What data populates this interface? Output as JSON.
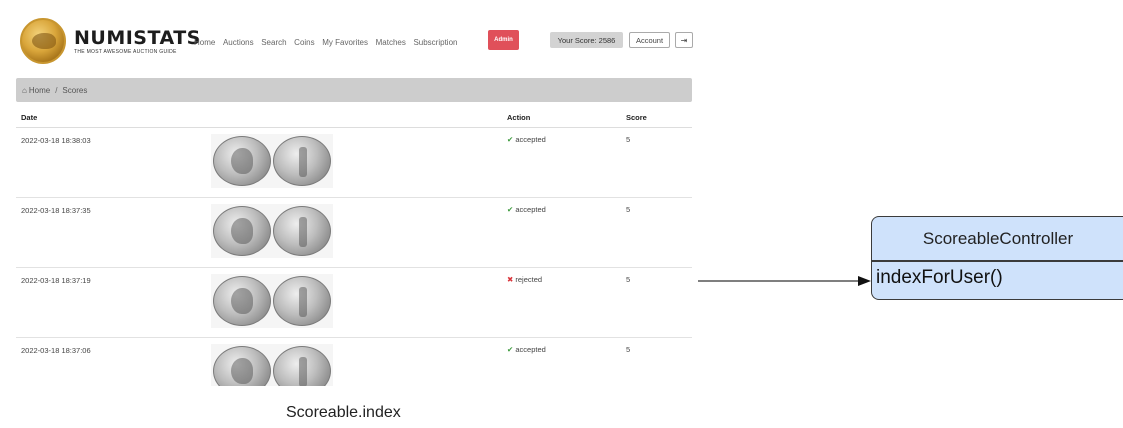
{
  "screenshot": {
    "logo": {
      "title": "NUMISTATS",
      "subtitle": "THE MOST AWESOME AUCTION GUIDE"
    },
    "nav": [
      "Home",
      "Auctions",
      "Search",
      "Coins",
      "My Favorites",
      "Matches",
      "Subscription"
    ],
    "admin_label": "Admin",
    "score_label": "Your Score: 2586",
    "account_label": "Account",
    "logout_icon": "sign-out-icon",
    "breadcrumb": {
      "home_icon": "⌂",
      "home": "Home",
      "sep": "/",
      "current": "Scores"
    },
    "table": {
      "headers": {
        "date": "Date",
        "action": "Action",
        "score": "Score"
      },
      "rows": [
        {
          "date": "2022-03-18 18:38:03",
          "status_icon": "✔",
          "action": "accepted",
          "score": "5"
        },
        {
          "date": "2022-03-18 18:37:35",
          "status_icon": "✔",
          "action": "accepted",
          "score": "5"
        },
        {
          "date": "2022-03-18 18:37:19",
          "status_icon": "✖",
          "action": "rejected",
          "score": "5"
        },
        {
          "date": "2022-03-18 18:37:06",
          "status_icon": "✔",
          "action": "accepted",
          "score": "5"
        }
      ]
    }
  },
  "caption": "Scoreable.index",
  "class_box": {
    "name": "ScoreableController",
    "method": "indexForUser()"
  },
  "colors": {
    "class_fill": "#cfe2fb",
    "admin": "#e0505a",
    "accepted": "#3a9a3a",
    "rejected": "#d9343a"
  }
}
